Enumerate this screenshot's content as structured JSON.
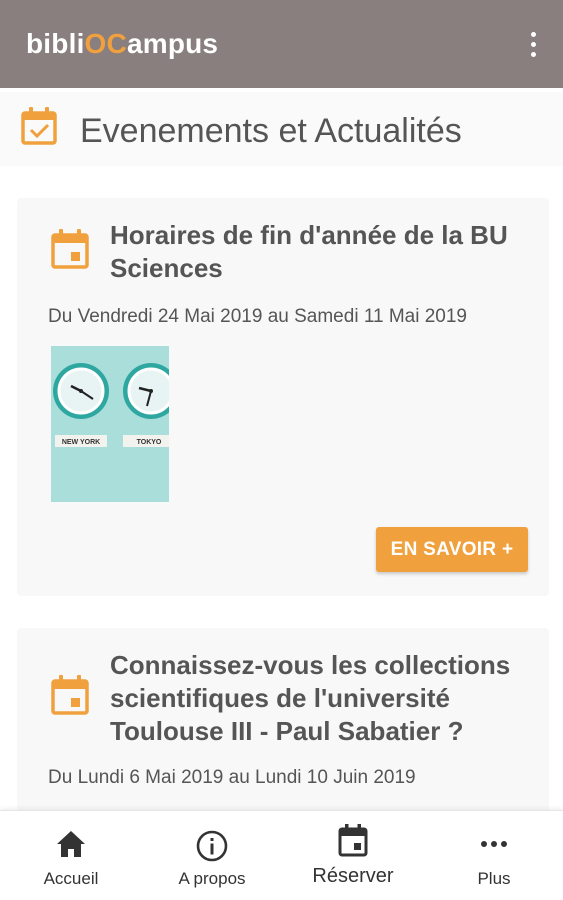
{
  "app": {
    "title_prefix": "bibli",
    "title_accent": "OC",
    "title_suffix": "ampus",
    "accent_color": "#f0a13e",
    "appbar_color": "#8a7f7f",
    "menu_icon": "more-vert-icon"
  },
  "section": {
    "title": "Evenements et Actualités",
    "icon": "calendar-check-icon"
  },
  "events": [
    {
      "title": "Horaires de fin d'année de la BU Sciences",
      "date": "Du Vendredi 24 Mai 2019 au Samedi 11 Mai 2019",
      "image_labels": [
        "NEW YORK",
        "TOKYO"
      ],
      "button": "EN SAVOIR +"
    },
    {
      "title": "Connaissez-vous les collections scientifiques de l'université Toulouse III - Paul Sabatier ?",
      "date": "Du Lundi 6 Mai 2019 au Lundi 10 Juin 2019"
    }
  ],
  "bottom_nav": [
    {
      "label": "Accueil",
      "icon": "home-icon"
    },
    {
      "label": "A propos",
      "icon": "info-icon"
    },
    {
      "label": "Réserver",
      "icon": "calendar-icon"
    },
    {
      "label": "Plus",
      "icon": "more-horiz-icon"
    }
  ]
}
